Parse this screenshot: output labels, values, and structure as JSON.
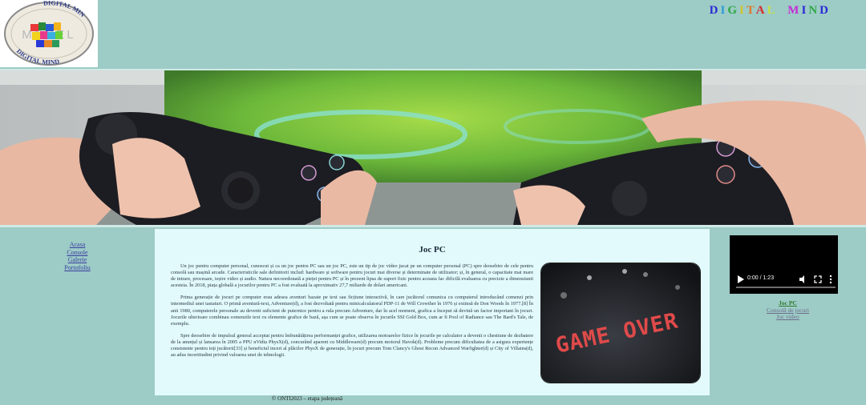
{
  "header": {
    "brand_letters": [
      {
        "ch": "D",
        "color": "#2b2bd6"
      },
      {
        "ch": "I",
        "color": "#2a9bd6"
      },
      {
        "ch": "G",
        "color": "#2ea845"
      },
      {
        "ch": "I",
        "color": "#d6c32b"
      },
      {
        "ch": "T",
        "color": "#e07a2a"
      },
      {
        "ch": "A",
        "color": "#d62b2b"
      },
      {
        "ch": "L",
        "color": "#c5e04a"
      },
      {
        "ch": " ",
        "color": "#000000"
      },
      {
        "ch": " ",
        "color": "#000000"
      },
      {
        "ch": "M",
        "color": "#c52bd6"
      },
      {
        "ch": "I",
        "color": "#2b2bd6"
      },
      {
        "ch": "N",
        "color": "#2ea845"
      },
      {
        "ch": "D",
        "color": "#2b2bd6"
      }
    ],
    "logo_texts": {
      "top": "DIGITAL MIND",
      "bottom": "DIGITAL MIND",
      "center": "MOBEL"
    }
  },
  "nav": {
    "items": [
      "Acasa",
      "Console",
      "Galerie",
      "Portofoliu"
    ]
  },
  "main": {
    "title": "Joc PC",
    "paragraphs": [
      "Un joc pentru computer personal, cunoscut și ca un joc pentru PC sau un joc PC, este un tip de joc video jucat pe un computer personal (PC) spre deosebire de cele pentru consolă sau mașină arcade. Caracteristicile sale definitorii includ: hardware și software pentru jocuri mai diverse și determinate de utilizator; și, în general, o capacitate mai mare de intrare, procesare, ieșire video și audio. Natura necoordonată a pieței pentru PC și în prezent lipsa de suport fizic pentru aceasta fac dificilă evaluarea cu precizie a dimensiunii acesteia. În 2018, piața globală a jocurilor pentru PC a fost evaluată la aproximativ 27,7 miliarde de dolari americani.",
      "Prima generație de jocuri pe computer erau adesea aventuri bazate pe text sau ficțiune interactivă, în care jucătorul comunica cu computerul introducând comenzi prin intermediul unei tastaturi. O primă aventură-text, Adventure(d), a fost dezvoltată pentru minicalculatorul PDP-11 de Will Crowther în 1976 și extinsă de Don Woods în 1977.[8] În anii 1980, computerele personale au devenit suficient de puternice pentru a rula precum Adventure, dar în acel moment, grafica a început să devină un factor important în jocuri. Jocurile ulterioare combinau comenzile text cu elemente grafice de bază, așa cum se poate observa în jocurile SSI Gold Box, cum ar fi Pool of Radiance sau The Bard's Tale, de exemplu.",
      "Spre deosebire de impulsul general acceptat pentru îmbunătățirea performanței grafice, utilizarea motoarelor fizice în jocurile pe calculator a devenit o chestiune de dezbatere de la anunțul și lansarea în 2005 a PPU nVidia PhysX(d), concurând aparent cu Middleware(d) precum motorul Havok(d). Probleme precum dificultatea de a asigura experiențe consistente pentru toți jucătorii[33] și beneficiul incert al plăcilor PhysX de generație, în jocuri precum Tom Clancy's Ghost Recon Advanced Warfighter(d) și City of Villains(d), au adus incertitudini privind valoarea unei de tehnologii."
    ],
    "image_text": "GAME OVER"
  },
  "video": {
    "time": "0:00 / 1:23"
  },
  "right_links": [
    {
      "label": "Joc PC",
      "active": true
    },
    {
      "label": "Consolă de jocuri",
      "active": false
    },
    {
      "label": "Joc video",
      "active": false
    }
  ],
  "footer": {
    "text": "© ONTI2023 – etapa județeană"
  }
}
